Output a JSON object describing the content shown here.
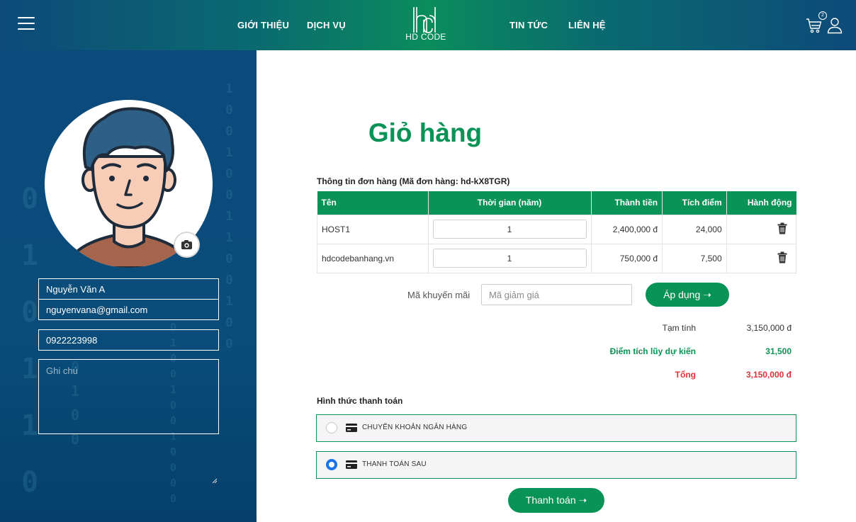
{
  "header": {
    "nav": [
      "GIỚI THIỆU",
      "DỊCH VỤ",
      "TIN TỨC",
      "LIÊN HỆ"
    ],
    "logo_text": "HD CODE",
    "cart_count": "2",
    "icons": [
      "menu-icon",
      "cart-icon",
      "user-icon"
    ]
  },
  "profile": {
    "name": "Nguyễn Văn A",
    "email": "nguyenvana@gmail.com",
    "phone": "0922223998",
    "note_placeholder": "Ghi chú",
    "icons": [
      "avatar",
      "camera-icon"
    ]
  },
  "cart": {
    "title": "Giỏ hàng",
    "order_info": "Thông tin đơn hàng (Mã đơn hàng: hd-kX8TGR)",
    "columns": [
      "Tên",
      "Thời gian (năm)",
      "Thành tiền",
      "Tích điểm",
      "Hành động"
    ],
    "rows": [
      {
        "name": "HOST1",
        "years": "1",
        "price": "2,400,000 đ",
        "points": "24,000"
      },
      {
        "name": "hdcodebanhang.vn",
        "years": "1",
        "price": "750,000 đ",
        "points": "7,500"
      }
    ],
    "promo_label": "Mã khuyến mãi",
    "promo_placeholder": "Mã giảm giá",
    "apply_label": "Áp dụng",
    "subtotal_label": "Tạm tính",
    "subtotal": "3,150,000 đ",
    "points_label": "Điểm tích lũy dự kiến",
    "points_total": "31,500",
    "total_label": "Tổng",
    "total": "3,150,000 đ"
  },
  "payment": {
    "title": "Hình thức thanh toán",
    "options": [
      {
        "label": "CHUYỂN KHOẢN NGÂN HÀNG",
        "selected": false
      },
      {
        "label": "THANH TOÁN SAU",
        "selected": true
      }
    ],
    "checkout_label": "Thanh toán"
  },
  "colors": {
    "brand_green": "#0a9356",
    "sidebar_blue": "#0c4a7c",
    "total_red": "#e0303a",
    "radio_blue": "#1a73e8"
  }
}
